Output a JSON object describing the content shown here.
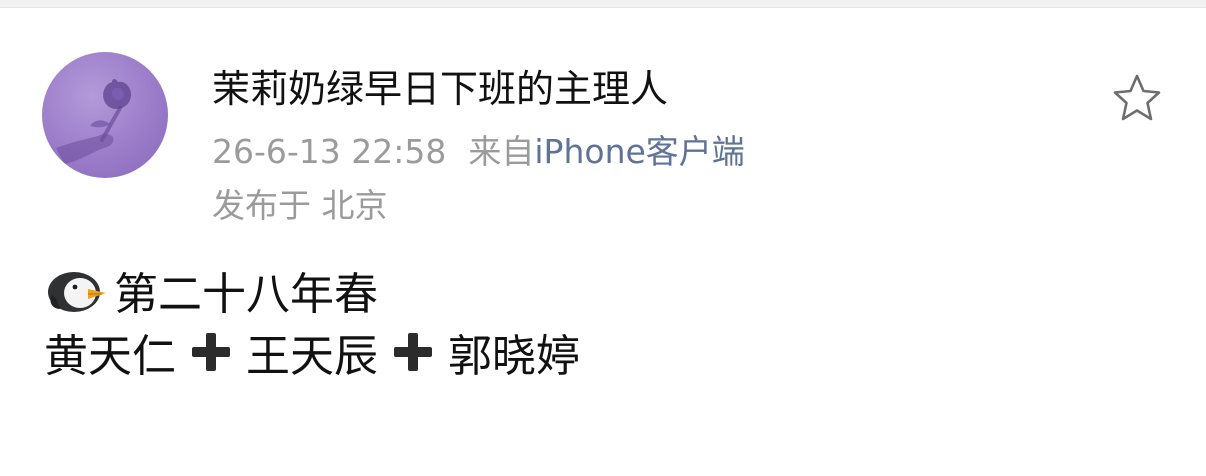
{
  "post": {
    "author": {
      "name": "茉莉奶绿早日下班的主理人"
    },
    "time": "26-6-13 22:58",
    "source_prefix": "来自",
    "source_client": "iPhone客户端",
    "location": "发布于 北京",
    "content": {
      "line1_text": "第二十八年春",
      "line1_icon": "penguin-icon",
      "line2": [
        "黄天仁",
        "王天辰",
        "郭晓婷"
      ],
      "line2_separator_icon": "heavy-plus-icon"
    },
    "favorite_icon": "star-outline-icon"
  },
  "colors": {
    "text_primary": "#111111",
    "text_secondary": "#9b9b9b",
    "client_link": "#5f7396",
    "avatar_bg": "#9a7cc9"
  }
}
